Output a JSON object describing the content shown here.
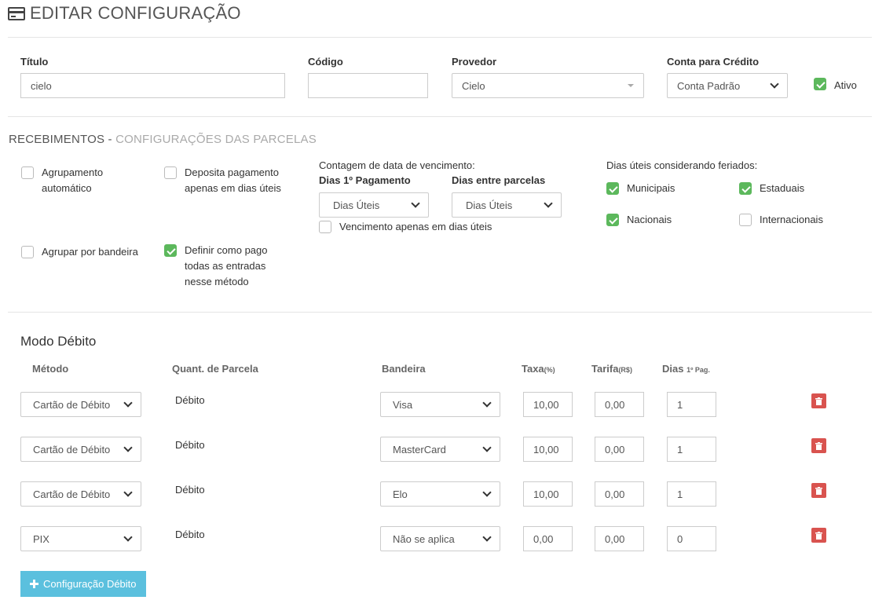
{
  "page": {
    "title": "EDITAR CONFIGURAÇÃO"
  },
  "form": {
    "titulo": {
      "label": "Título",
      "value": "cielo"
    },
    "codigo": {
      "label": "Código",
      "value": ""
    },
    "provedor": {
      "label": "Provedor",
      "value": "Cielo"
    },
    "conta": {
      "label": "Conta para Crédito",
      "value": "Conta Padrão"
    },
    "ativo": {
      "label": "Ativo",
      "checked": true
    }
  },
  "recebimentos": {
    "title": "RECEBIMENTOS",
    "sep": " - ",
    "subtitle": "CONFIGURAÇÕES DAS PARCELAS",
    "agrupamento_l1": "Agrupamento",
    "agrupamento_l2": "automático",
    "deposita_l1": "Deposita pagamento",
    "deposita_l2": "apenas em dias úteis",
    "agrupar_bandeira": "Agrupar por bandeira",
    "definir_l1": "Definir como pago",
    "definir_l2": "todas as entradas",
    "definir_l3": "nesse método",
    "contagem_label": "Contagem de data de vencimento:",
    "dias1_label": "Dias 1º Pagamento",
    "dias1_value": "Dias Úteis",
    "entre_label": "Dias entre parcelas",
    "entre_value": "Dias Úteis",
    "venc_util": "Vencimento apenas em dias úteis",
    "feriados_label": "Dias úteis considerando feriados:",
    "municipais": "Municipais",
    "estaduais": "Estaduais",
    "nacionais": "Nacionais",
    "internacionais": "Internacionais"
  },
  "debito": {
    "title": "Modo Débito",
    "headers": {
      "metodo": "Método",
      "parcela": "Quant. de Parcela",
      "bandeira": "Bandeira",
      "taxa": "Taxa",
      "taxa_unit": "(%)",
      "tarifa": "Tarifa",
      "tarifa_unit": "(R$)",
      "dias": "Dias ",
      "dias_unit": "1º Pag."
    },
    "rows": [
      {
        "metodo": "Cartão de Débito",
        "parcela": "Débito",
        "bandeira": "Visa",
        "taxa": "10,00",
        "tarifa": "0,00",
        "dias": "1"
      },
      {
        "metodo": "Cartão de Débito",
        "parcela": "Débito",
        "bandeira": "MasterCard",
        "taxa": "10,00",
        "tarifa": "0,00",
        "dias": "1"
      },
      {
        "metodo": "Cartão de Débito",
        "parcela": "Débito",
        "bandeira": "Elo",
        "taxa": "10,00",
        "tarifa": "0,00",
        "dias": "1"
      },
      {
        "metodo": "PIX",
        "parcela": "Débito",
        "bandeira": "Não se aplica",
        "taxa": "0,00",
        "tarifa": "0,00",
        "dias": "0"
      }
    ],
    "add_button": "Configuração Débito"
  },
  "colors": {
    "accent_green": "#5cb85c",
    "danger": "#d9534f",
    "info": "#5bc0de"
  },
  "icons": {
    "title": "credit-card-icon",
    "delete": "trash-icon",
    "add": "plus-icon"
  }
}
